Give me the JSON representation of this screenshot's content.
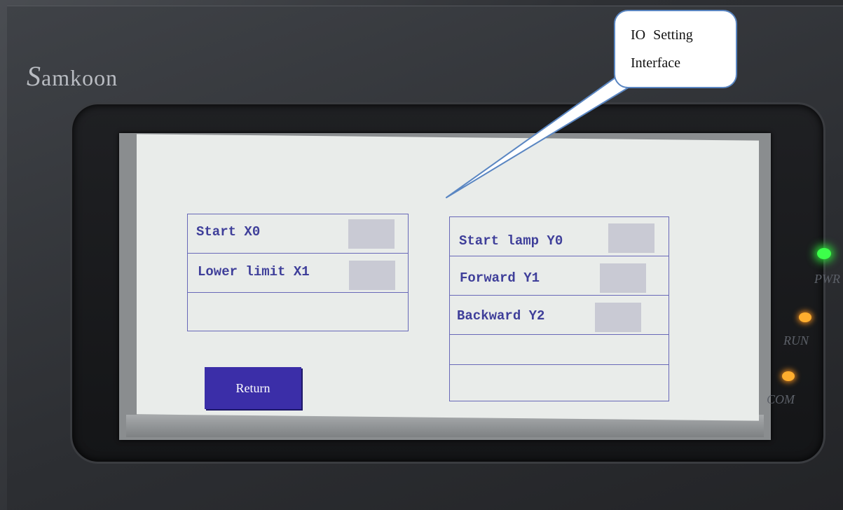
{
  "device": {
    "brand": "amkoon",
    "brand_initial": "S"
  },
  "inputs_panel": {
    "rows": [
      {
        "label": "Start X0"
      },
      {
        "label": "Lower limit X1"
      },
      {
        "label": ""
      }
    ]
  },
  "outputs_panel": {
    "rows": [
      {
        "label": "Start lamp Y0"
      },
      {
        "label": "Forward Y1"
      },
      {
        "label": "Backward Y2"
      },
      {
        "label": ""
      },
      {
        "label": ""
      }
    ]
  },
  "buttons": {
    "return_label": "Return"
  },
  "indicators": {
    "pwr": {
      "label": "PWR",
      "color": "#3cff4a"
    },
    "run": {
      "label": "RUN",
      "color": "#ffae2e"
    },
    "com": {
      "label": "COM",
      "color": "#ffae2e"
    }
  },
  "callout": {
    "text": "IO Setting Interface"
  },
  "colors": {
    "screen_background": "#e9ecea",
    "frame_line": "#6868b8",
    "label_text": "#3f3f9a",
    "indicator_box": "#c9cad4",
    "button_fill": "#3b2ea8",
    "callout_border": "#5a86c2"
  }
}
